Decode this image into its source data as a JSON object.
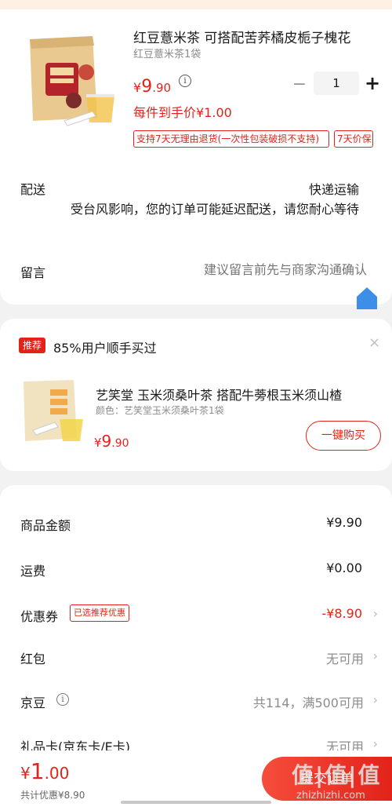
{
  "product": {
    "title": "红豆薏米茶 可搭配苦荞橘皮栀子槐花",
    "spec": "红豆薏米茶1袋",
    "price_currency": "¥",
    "price_int": "9",
    "price_dec": ".90",
    "info_icon": "i",
    "minus": "−",
    "quantity": "1",
    "plus": "+",
    "unit_price": "每件到手价¥1.00",
    "tag_return": "支持7天无理由退货(一次性包装破损不支持)",
    "tag_price": "7天价保"
  },
  "delivery": {
    "label": "配送",
    "method": "快递运输",
    "note": "受台风影响，您的订单可能延迟配送，请您耐心等待"
  },
  "message": {
    "label": "留言",
    "placeholder": "建议留言前先与商家沟通确认"
  },
  "recommend": {
    "badge": "推荐",
    "title": "85%用户顺手买过",
    "close": "×",
    "name": "艺笑堂 玉米须桑叶茶 搭配牛蒡根玉米须山楂",
    "spec": "颜色：艺笑堂玉米须桑叶茶1袋",
    "price_currency": "¥",
    "price_int": "9",
    "price_dec": ".90",
    "buy_label": "一键购买"
  },
  "summary": {
    "goods_label": "商品金额",
    "goods_value": "¥9.90",
    "shipping_label": "运费",
    "shipping_value": "¥0.00",
    "coupon_label": "优惠券",
    "coupon_tag": "已选推荐优惠",
    "coupon_value": "-¥8.90",
    "redpack_label": "红包",
    "redpack_value": "无可用",
    "jingdou_label": "京豆",
    "jingdou_info": "i",
    "jingdou_value": "共114，满500可用",
    "giftcard_label": "礼品卡(京东卡/E卡)",
    "giftcard_value": "无可用",
    "chevron": "›"
  },
  "footer": {
    "total_currency": "¥",
    "total_int": "1",
    "total_dec": ".00",
    "saved": "共计优惠¥8.90",
    "submit_label": "提交订单",
    "watermark": "值|值|值",
    "watermark_site": "zhizhizhi.com"
  },
  "colors": {
    "accent": "#e2231a",
    "muted": "#8c8c8c",
    "background": "#f2f2f2"
  },
  "icons": [
    "info-icon",
    "minus-icon",
    "plus-icon",
    "close-icon",
    "chevron-right-icon",
    "home-icon"
  ]
}
